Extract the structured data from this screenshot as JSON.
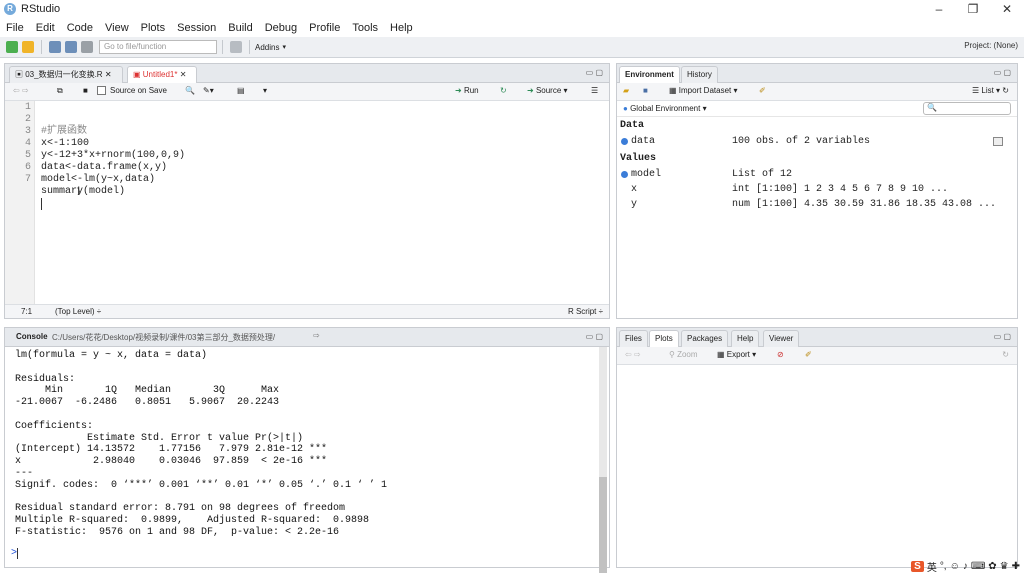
{
  "window": {
    "title": "RStudio"
  },
  "menu": [
    "File",
    "Edit",
    "Code",
    "View",
    "Plots",
    "Session",
    "Build",
    "Debug",
    "Profile",
    "Tools",
    "Help"
  ],
  "toolbar": {
    "goto_placeholder": "Go to file/function",
    "addins": "Addins",
    "project": "Project: (None)"
  },
  "editor": {
    "tabs": [
      "03_数据归一化变换.R",
      "Untitled1*"
    ],
    "source_on_save": "Source on Save",
    "run": "Run",
    "source": "Source",
    "lines": [
      "#扩展函数",
      "x<-1:100",
      "y<-12+3*x+rnorm(100,0,9)",
      "data<-data.frame(x,y)",
      "model<-lm(y~x,data)",
      "summary(model)",
      ""
    ],
    "line_numbers": [
      "1",
      "2",
      "3",
      "4",
      "5",
      "6",
      "7"
    ],
    "status_pos": "7:1",
    "status_level": "(Top Level) ÷",
    "status_type": "R Script ÷"
  },
  "console": {
    "tab": "Console",
    "path": "C:/Users/花花/Desktop/视频录制/课件/03第三部分_数据预处理/",
    "output": "lm(formula = y ~ x, data = data)\n\nResiduals:\n     Min       1Q   Median       3Q      Max \n-21.0067  -6.2486   0.8051   5.9067  20.2243 \n\nCoefficients:\n            Estimate Std. Error t value Pr(>|t|)    \n(Intercept) 14.13572    1.77156   7.979 2.81e-12 ***\nx            2.98040    0.03046  97.859  < 2e-16 ***\n---\nSignif. codes:  0 ‘***’ 0.001 ‘**’ 0.01 ‘*’ 0.05 ‘.’ 0.1 ‘ ’ 1\n\nResidual standard error: 8.791 on 98 degrees of freedom\nMultiple R-squared:  0.9899,\tAdjusted R-squared:  0.9898 \nF-statistic:  9576 on 1 and 98 DF,  p-value: < 2.2e-16\n",
    "prompt": ">"
  },
  "environment": {
    "tabs": [
      "Environment",
      "History"
    ],
    "import_dataset": "Import Dataset",
    "list_label": "List",
    "global_env": "Global Environment",
    "data_header": "Data",
    "values_header": "Values",
    "data_row": {
      "name": "data",
      "value": "100 obs. of 2 variables"
    },
    "model_row": {
      "name": "model",
      "value": "List of 12"
    },
    "x_row": {
      "name": "x",
      "value": "int [1:100] 1 2 3 4 5 6 7 8 9 10 ..."
    },
    "y_row": {
      "name": "y",
      "value": "num [1:100] 4.35 30.59 31.86 18.35 43.08 ..."
    }
  },
  "files": {
    "tabs": [
      "Files",
      "Plots",
      "Packages",
      "Help",
      "Viewer"
    ],
    "zoom": "Zoom",
    "export": "Export"
  },
  "tray": {
    "ime": "英"
  }
}
